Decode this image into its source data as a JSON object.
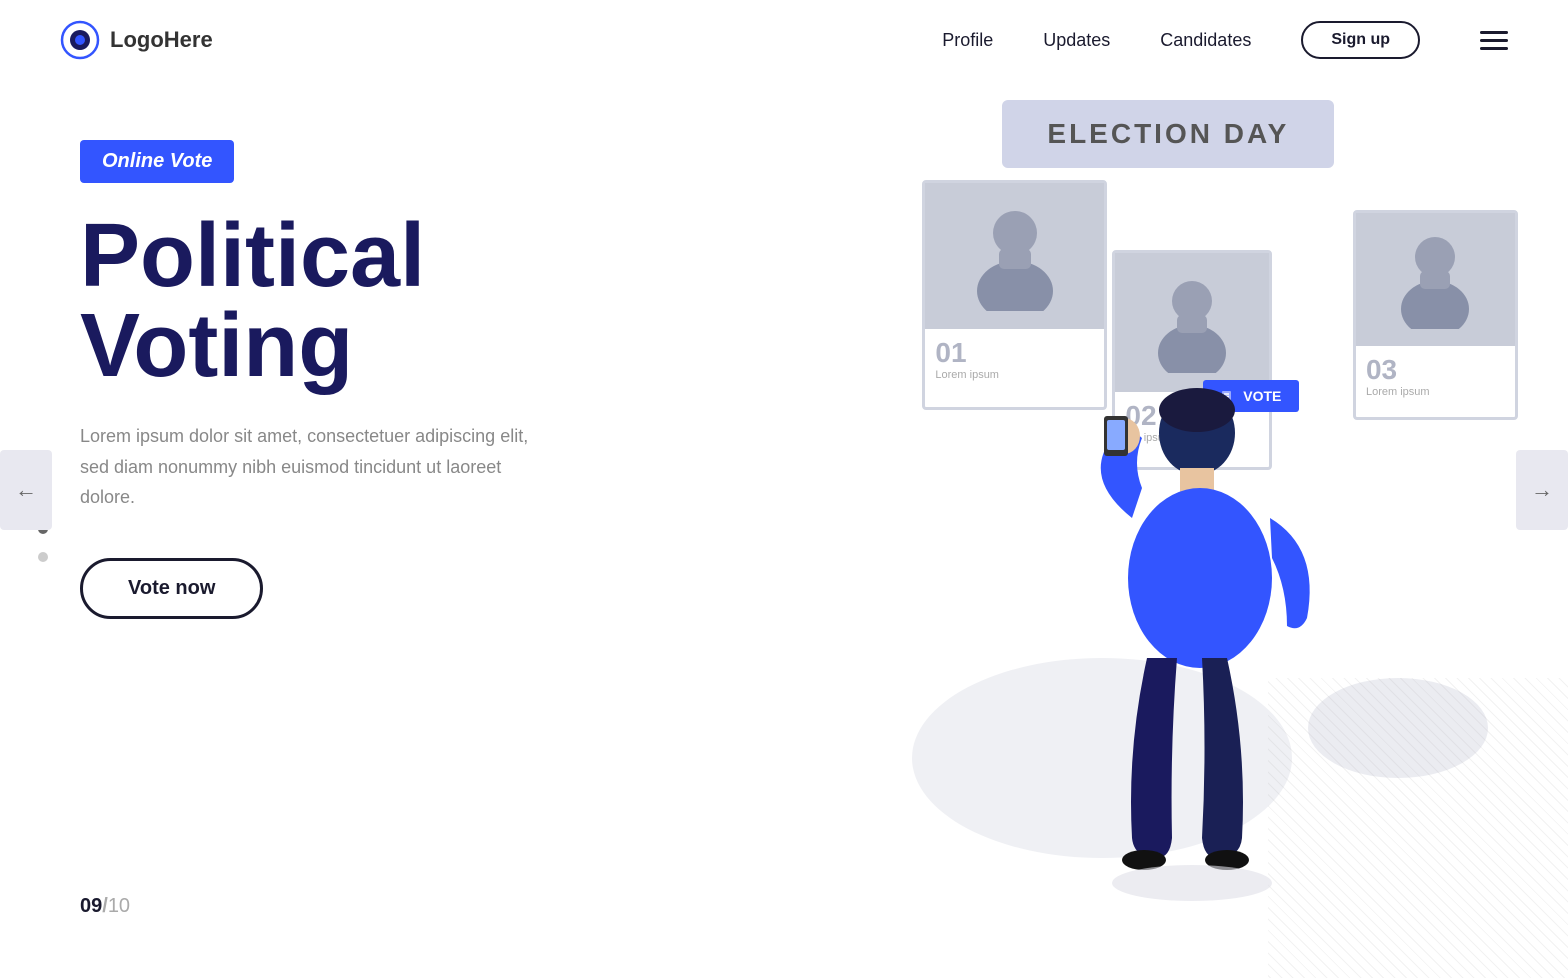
{
  "header": {
    "logo_text_regular": "Logo",
    "logo_text_bold": "Here",
    "nav_links": [
      {
        "id": "profile",
        "label": "Profile"
      },
      {
        "id": "updates",
        "label": "Updates"
      },
      {
        "id": "candidates",
        "label": "Candidates"
      }
    ],
    "signup_label": "Sign up"
  },
  "hero": {
    "badge_label": "Online Vote",
    "title_line1": "Political",
    "title_line2": "Voting",
    "description": "Lorem ipsum dolor sit amet, consectetuer adipiscing elit, sed diam nonummy nibh euismod tincidunt ut laoreet dolore.",
    "cta_label": "Vote now"
  },
  "pagination": {
    "current": "09",
    "separator": "/",
    "total": "10"
  },
  "election_banner": {
    "text": "ELECTION DAY"
  },
  "candidates": [
    {
      "number": "01",
      "lorem": "Lorem ipsum"
    },
    {
      "number": "02",
      "lorem": "em ipsum"
    },
    {
      "number": "03",
      "lorem": "Lorem ipsum"
    }
  ],
  "vote_badge": {
    "label": "VOTE"
  },
  "nav_arrows": {
    "left": "←",
    "right": "→"
  },
  "dots": [
    {
      "active": false
    },
    {
      "active": true
    },
    {
      "active": false
    }
  ],
  "colors": {
    "accent_blue": "#3355ff",
    "dark_navy": "#1a1a5e",
    "card_border": "#d0d4e0"
  }
}
